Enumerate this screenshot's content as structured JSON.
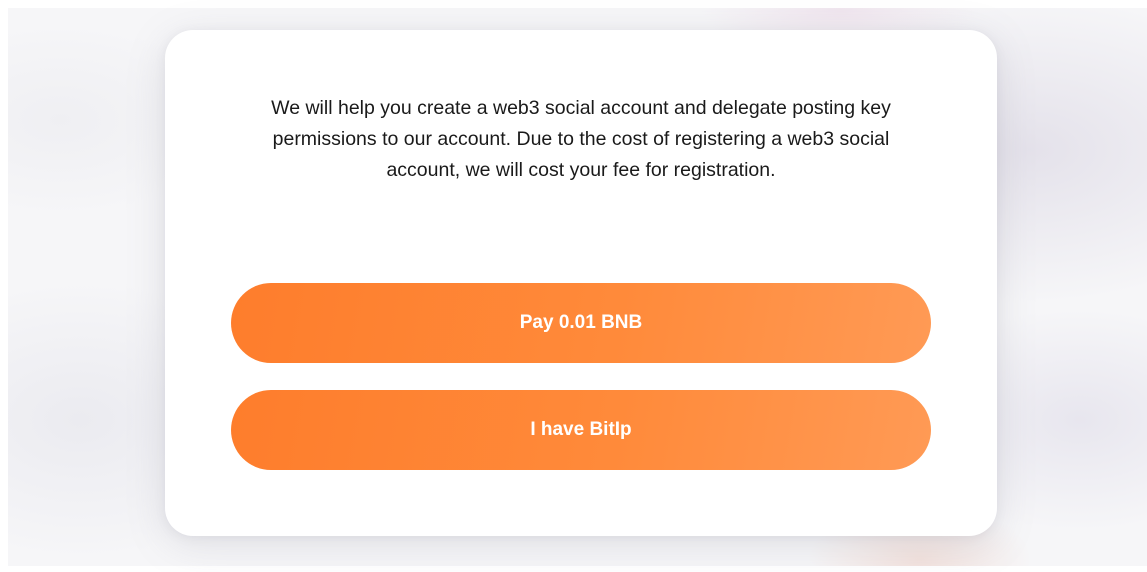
{
  "dialog": {
    "message": "We will help you create a web3 social account and delegate posting key permissions to our account. Due to the cost of registering a web3 social account, we will cost your fee for registration.",
    "buttons": {
      "pay_label": "Pay 0.01 BNB",
      "bitip_label": "I have BitIp"
    }
  },
  "colors": {
    "accent": "#ff8533",
    "card_background": "#ffffff",
    "text": "#1a1a1a",
    "button_text": "#ffffff"
  }
}
